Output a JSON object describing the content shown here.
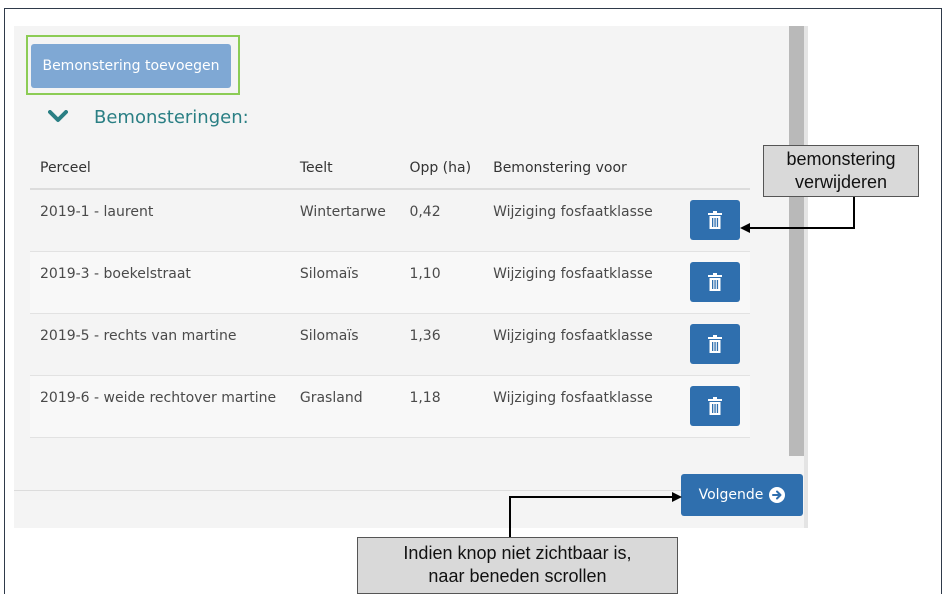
{
  "toolbar": {
    "add_label": "Bemonstering toevoegen"
  },
  "section": {
    "title": "Bemonsteringen:"
  },
  "table": {
    "headers": [
      "Perceel",
      "Teelt",
      "Opp (ha)",
      "Bemonstering voor"
    ],
    "rows": [
      {
        "perceel": "2019-1 - laurent",
        "teelt": "Wintertarwe",
        "opp": "0,42",
        "bemonstering": "Wijziging fosfaatklasse"
      },
      {
        "perceel": "2019-3 - boekelstraat",
        "teelt": "Silomaïs",
        "opp": "1,10",
        "bemonstering": "Wijziging fosfaatklasse"
      },
      {
        "perceel": "2019-5 - rechts van martine",
        "teelt": "Silomaïs",
        "opp": "1,36",
        "bemonstering": "Wijziging fosfaatklasse"
      },
      {
        "perceel": "2019-6 - weide rechtover martine",
        "teelt": "Grasland",
        "opp": "1,18",
        "bemonstering": "Wijziging fosfaatklasse"
      }
    ]
  },
  "footer": {
    "next_label": "Volgende"
  },
  "annotations": {
    "delete_line1": "bemonstering",
    "delete_line2": "verwijderen",
    "scroll_line1": "Indien knop niet zichtbaar is,",
    "scroll_line2": "naar beneden scrollen"
  },
  "icons": {
    "section_toggle": "chevron-down-icon",
    "delete": "trash-icon",
    "next": "arrow-right-circle-icon"
  },
  "colors": {
    "primary": "#2f6fae",
    "add_button": "#7fa8d4",
    "section_title": "#2a7f84",
    "highlight_border": "#8ccc55"
  }
}
